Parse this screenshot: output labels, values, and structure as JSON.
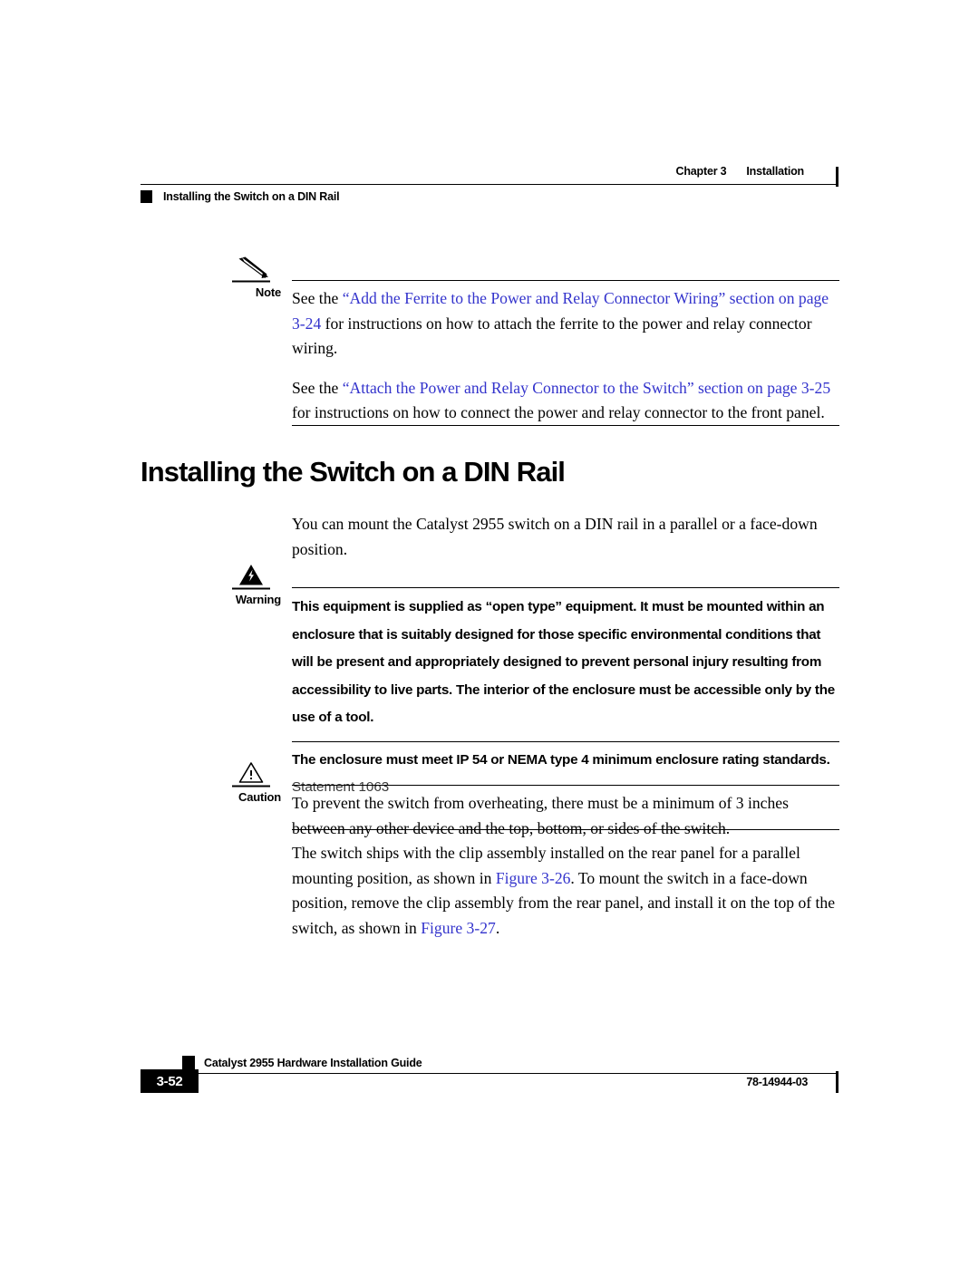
{
  "header": {
    "chapter_label": "Chapter 3",
    "chapter_topic": "Installation",
    "section_title": "Installing the Switch on a DIN Rail"
  },
  "note": {
    "label": "Note",
    "icon": "pencil-icon",
    "paragraph1": {
      "lead": "See the ",
      "link1": "“Add the Ferrite to the Power and Relay Connector Wiring” section on",
      "link2": "page 3-24",
      "tail": " for instructions on how to attach the ferrite to the power and relay connector wiring."
    },
    "paragraph2": {
      "lead": "See the ",
      "link1": "“Attach the Power and Relay Connector to the Switch” section on",
      "link2": "page 3-25",
      "tail": " for instructions on how to connect the power and relay connector to the front panel."
    }
  },
  "heading": "Installing the Switch on a DIN Rail",
  "intro_paragraph": "You can mount the Catalyst 2955 switch on a DIN rail in a parallel or a face-down position.",
  "warning": {
    "label": "Warning",
    "icon": "warning-triangle-lightning-icon",
    "paragraph1": "This equipment is supplied as “open type” equipment. It must be mounted within an enclosure that is suitably designed for those specific environmental conditions that will be present and appropriately designed to prevent personal injury resulting from accessibility to live parts. The interior of the enclosure must be accessible only by the use of a tool.",
    "paragraph2_bold": "The enclosure must meet IP 54 or NEMA type 4 minimum enclosure rating standards.",
    "paragraph2_statement": " Statement 1063"
  },
  "caution": {
    "label": "Caution",
    "icon": "caution-triangle-exclamation-icon",
    "paragraph1": "To prevent the switch from overheating, there must be a minimum of 3 inches between any other device and the top, bottom, or sides of the switch."
  },
  "closing_paragraph": {
    "part1": "The switch ships with the clip assembly installed on the rear panel for a parallel mounting position, as shown in ",
    "link1": "Figure 3-26",
    "part2": ". To mount the switch in a face-down position, remove the clip assembly from the rear panel, and install it on the top of the switch, as shown in ",
    "link2": "Figure 3-27",
    "part3": "."
  },
  "footer": {
    "guide_title": "Catalyst 2955 Hardware Installation Guide",
    "page_number": "3-52",
    "doc_number": "78-14944-03"
  },
  "colors": {
    "link": "#3333cc",
    "text": "#000000",
    "background": "#ffffff"
  }
}
